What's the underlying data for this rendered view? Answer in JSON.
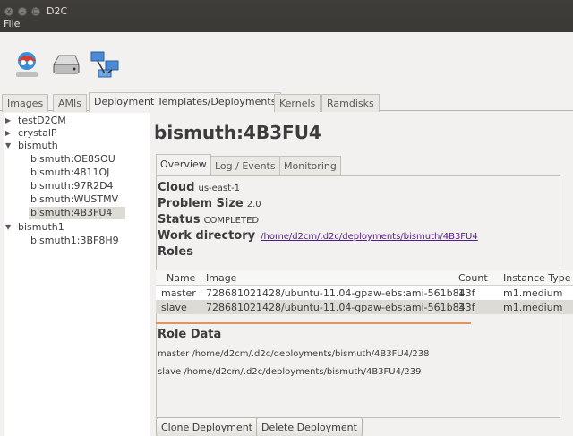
{
  "window": {
    "title": "D2C"
  },
  "menu": {
    "file": "File"
  },
  "toolbar": {
    "icons": [
      "user-icon",
      "drive-icon",
      "network-icon"
    ]
  },
  "tabs": [
    "Images",
    "AMIs",
    "Deployment Templates/Deployments",
    "Kernels",
    "Ramdisks"
  ],
  "tree": {
    "items": [
      {
        "label": "testD2CM"
      },
      {
        "label": "crystalP"
      },
      {
        "label": "bismuth"
      },
      {
        "label": "bismuth:OE8SOU"
      },
      {
        "label": "bismuth:4811OJ"
      },
      {
        "label": "bismuth:97R2D4"
      },
      {
        "label": "bismuth:WUSTMV"
      },
      {
        "label": "bismuth:4B3FU4"
      },
      {
        "label": "bismuth1"
      },
      {
        "label": "bismuth1:3BF8H9"
      }
    ]
  },
  "main": {
    "title": "bismuth:4B3FU4",
    "subtabs": [
      "Overview",
      "Log / Events",
      "Monitoring"
    ],
    "cloud_label": "Cloud",
    "cloud_value": "us-east-1",
    "problem_size_label": "Problem Size",
    "problem_size_value": "2.0",
    "status_label": "Status",
    "status_value": "COMPLETED",
    "work_dir_label": "Work directory",
    "work_dir_value": "/home/d2cm/.d2c/deployments/bismuth/4B3FU4",
    "roles_label": "Roles",
    "roles_table": {
      "headers": [
        "Name",
        "Image",
        "Count",
        "Instance Type"
      ],
      "rows": [
        [
          "master",
          "728681021428/ubuntu-11.04-gpaw-ebs:ami-561b843f",
          "1",
          "m1.medium"
        ],
        [
          "slave",
          "728681021428/ubuntu-11.04-gpaw-ebs:ami-561b843f",
          "3",
          "m1.medium"
        ]
      ]
    },
    "role_data_label": "Role Data",
    "role_data_lines": [
      "master /home/d2cm/.d2c/deployments/bismuth/4B3FU4/238",
      "slave /home/d2cm/.d2c/deployments/bismuth/4B3FU4/239"
    ],
    "buttons": {
      "clone": "Clone Deployment",
      "delete": "Delete Deployment"
    }
  }
}
